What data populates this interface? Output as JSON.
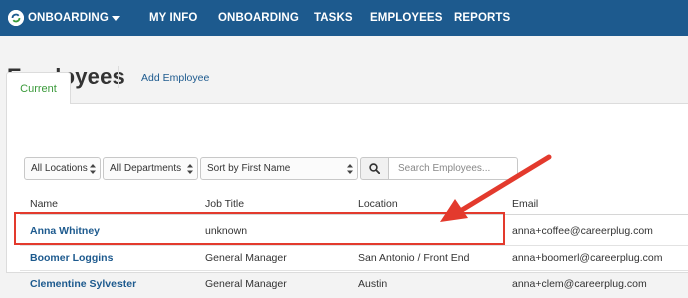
{
  "nav": {
    "brand": "ONBOARDING",
    "links": [
      "MY INFO",
      "ONBOARDING",
      "TASKS",
      "EMPLOYEES",
      "REPORTS"
    ]
  },
  "page": {
    "title": "Employees",
    "add_link": "Add Employee",
    "tab": "Current"
  },
  "filters": {
    "locations": "All Locations",
    "departments": "All Departments",
    "sort": "Sort by First Name",
    "search_placeholder": "Search Employees..."
  },
  "table": {
    "headers": [
      "Name",
      "Job Title",
      "Location",
      "Email"
    ],
    "rows": [
      {
        "name": "Anna Whitney",
        "title": "unknown",
        "location": "",
        "email": "anna+coffee@careerplug.com"
      },
      {
        "name": "Boomer Loggins",
        "title": "General Manager",
        "location": "San Antonio / Front End",
        "email": "anna+boomerl@careerplug.com"
      },
      {
        "name": "Clementine Sylvester",
        "title": "General Manager",
        "location": "Austin",
        "email": "anna+clem@careerplug.com"
      }
    ]
  },
  "colors": {
    "nav_bg": "#1d5a8e",
    "link": "#1d5a8e",
    "tab_text": "#3a9a3a",
    "annotation": "#e33a2d"
  }
}
